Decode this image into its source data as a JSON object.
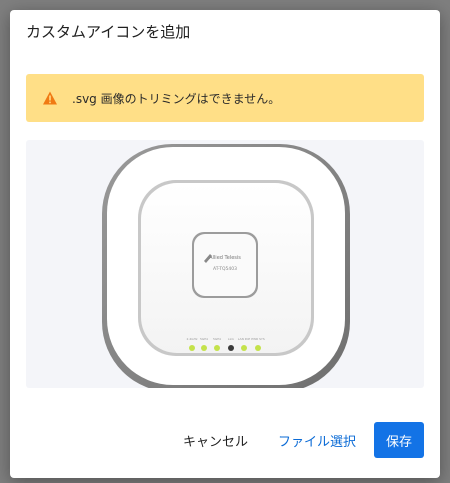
{
  "dialog": {
    "title": "カスタムアイコンを追加",
    "warning": {
      "icon": "warning-triangle-icon",
      "text": ".svg 画像のトリミングはできません。",
      "background": "#ffdf87",
      "icon_color": "#f07a13"
    },
    "preview": {
      "image": "access-point-device",
      "device": {
        "brand": "Allied Telesis",
        "model": "AT-TQ5403",
        "led_labels": [
          "2.4GHz",
          "5GHz",
          "5GHz",
          "Link",
          "LAN PoE",
          "PWR SYS"
        ]
      }
    },
    "actions": {
      "cancel_label": "キャンセル",
      "file_select_label": "ファイル選択",
      "save_label": "保存",
      "primary_color": "#1373e6"
    }
  }
}
